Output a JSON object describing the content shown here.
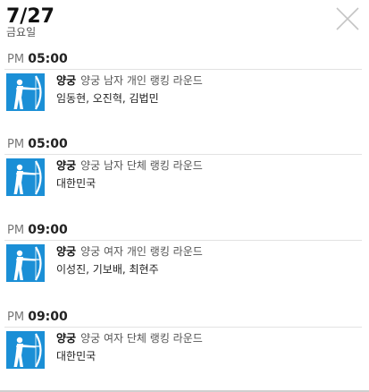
{
  "header": {
    "date": "7/27",
    "weekday": "금요일"
  },
  "colors": {
    "pictogram_bg": "#1b8fd6",
    "divider": "#e2e2e2",
    "close_icon": "#c4c4c4"
  },
  "sessions": [
    {
      "ampm": "PM",
      "time": "05:00",
      "sport": "양궁",
      "event": "양궁 남자 개인 랭킹 라운드",
      "athletes": "임동현, 오진혁, 김법민",
      "icon": "archery-pictogram-icon"
    },
    {
      "ampm": "PM",
      "time": "05:00",
      "sport": "양궁",
      "event": "양궁 남자 단체 랭킹 라운드",
      "athletes": "대한민국",
      "icon": "archery-pictogram-icon"
    },
    {
      "ampm": "PM",
      "time": "09:00",
      "sport": "양궁",
      "event": "양궁 여자 개인 랭킹 라운드",
      "athletes": "이성진, 기보배, 최현주",
      "icon": "archery-pictogram-icon"
    },
    {
      "ampm": "PM",
      "time": "09:00",
      "sport": "양궁",
      "event": "양궁 여자 단체 랭킹 라운드",
      "athletes": "대한민국",
      "icon": "archery-pictogram-icon"
    }
  ]
}
